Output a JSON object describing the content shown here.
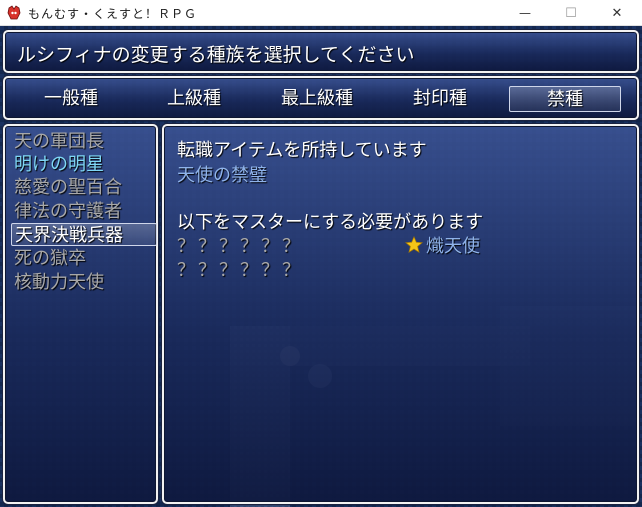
{
  "window": {
    "title": "もんむす・くえすと！ＲＰＧ",
    "minimize_glyph": "—",
    "maximize_glyph": "☐",
    "close_glyph": "✕"
  },
  "help": {
    "text": "ルシフィナの変更する種族を選択してください"
  },
  "categories": {
    "items": [
      "一般種",
      "上級種",
      "最上級種",
      "封印種",
      "禁種"
    ],
    "selected": "禁種"
  },
  "race_list": {
    "items": [
      "天の軍団長",
      "明けの明星",
      "慈愛の聖百合",
      "律法の守護者",
      "天界決戦兵器",
      "死の獄卒",
      "核動力天使"
    ],
    "active": "明けの明星",
    "selected": "天界決戦兵器"
  },
  "info": {
    "item_heading": "転職アイテムを所持しています",
    "item_name": "天使の禁璧",
    "master_heading": "以下をマスターにする必要があります",
    "req_1": "？？？？？？",
    "req_2": "？？？？？？",
    "req_3": "熾天使",
    "req_3_icon": "star-icon"
  },
  "colors": {
    "window_top": "#3c5496",
    "window_bottom": "#0e183e",
    "text_white": "#ffffff",
    "text_disabled": "#a8a8a8",
    "text_active": "#7fd7f5",
    "text_item": "#8fb3ea",
    "star": "#f5c518"
  }
}
